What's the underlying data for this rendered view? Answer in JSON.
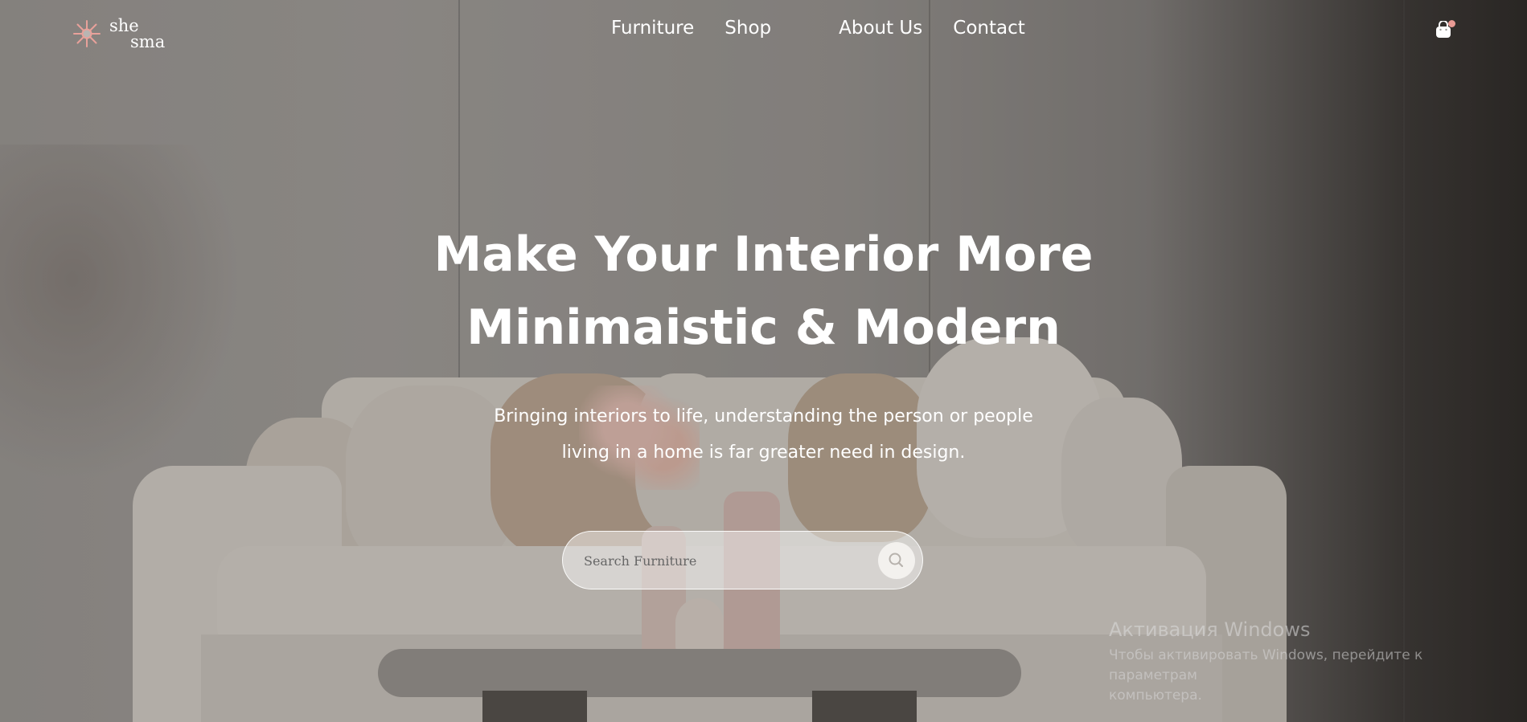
{
  "brand": {
    "line1": "she",
    "line2": "sma",
    "accent_color": "#e8a19a"
  },
  "nav": {
    "items": [
      {
        "label": "Furniture"
      },
      {
        "label": "Shop"
      },
      {
        "label": "About Us"
      },
      {
        "label": "Contact"
      }
    ],
    "cart_icon": "shopping-bag-icon",
    "cart_badge_color": "#e89a93"
  },
  "hero": {
    "title_line1": "Make Your Interior More",
    "title_line2": "Minimaistic & Modern",
    "subtitle_line1": "Bringing interiors to life, understanding the person or people",
    "subtitle_line2": "living in a home is far greater need in design."
  },
  "search": {
    "placeholder": "Search Furniture",
    "icon": "search-icon"
  },
  "watermark": {
    "title": "Активация Windows",
    "line1": "Чтобы активировать Windows, перейдите к параметрам",
    "line2": "компьютера."
  }
}
